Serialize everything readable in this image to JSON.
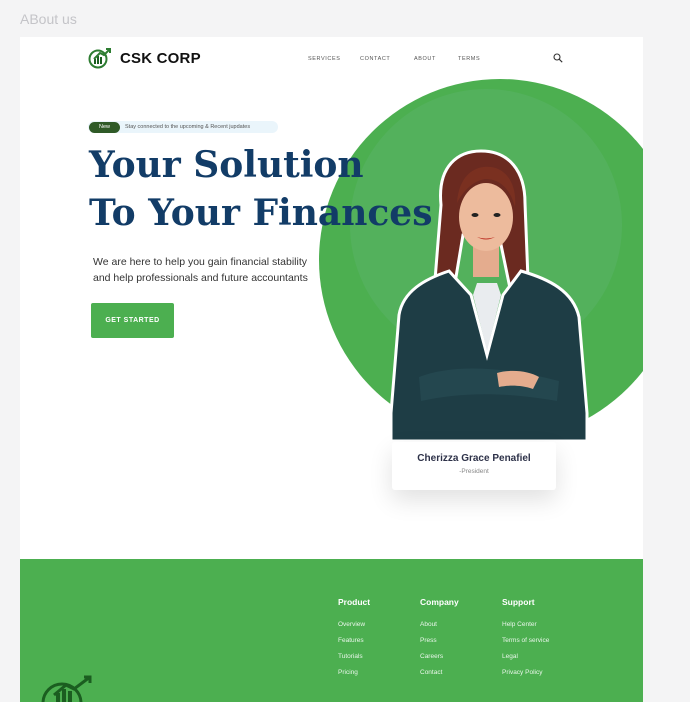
{
  "frame_label": "ABout us",
  "brand": {
    "name": "CSK CORP"
  },
  "nav": {
    "links": [
      "SERVICES",
      "CONTACT",
      "ABOUT",
      "TERMS"
    ]
  },
  "hero": {
    "badge": "New",
    "badge_text": "Stay connected to the upcoming & Recent jupdates",
    "title_line1": "Your Solution",
    "title_line2": "To Your Finances",
    "subtitle_line1": "We are here to help you gain financial stability",
    "subtitle_line2": "and help professionals and future accountants",
    "cta": "GET STARTED"
  },
  "person": {
    "name": "Cherizza Grace Penafiel",
    "role": "-President"
  },
  "footer": {
    "columns": [
      {
        "title": "Product",
        "links": [
          "Overview",
          "Features",
          "Tutorials",
          "Pricing"
        ]
      },
      {
        "title": "Company",
        "links": [
          "About",
          "Press",
          "Careers",
          "Contact"
        ]
      },
      {
        "title": "Support",
        "links": [
          "Help Center",
          "Terms of service",
          "Legal",
          "Privacy Policy"
        ]
      }
    ]
  },
  "colors": {
    "accent": "#4caf50",
    "title": "#123c67",
    "badge": "#2f5a27"
  }
}
